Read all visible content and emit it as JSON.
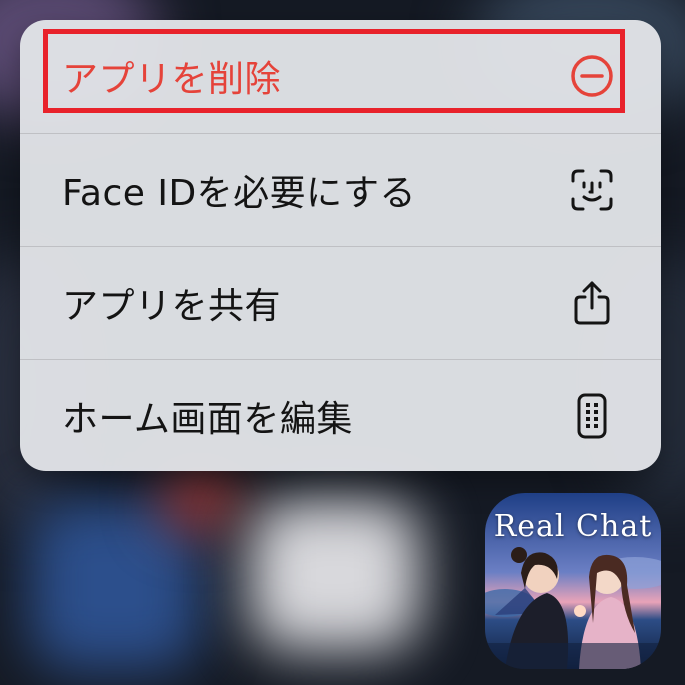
{
  "context_menu": {
    "items": [
      {
        "label": "アプリを削除",
        "icon": "minus-circle-icon",
        "destructive": true
      },
      {
        "label": "Face IDを必要にする",
        "icon": "face-id-icon",
        "destructive": false
      },
      {
        "label": "アプリを共有",
        "icon": "share-icon",
        "destructive": false
      },
      {
        "label": "ホーム画面を編集",
        "icon": "phone-grid-icon",
        "destructive": false
      }
    ]
  },
  "app_icon": {
    "title": "Real Chat"
  },
  "colors": {
    "destructive": "#e5433a",
    "highlight_border": "#e8222b",
    "menu_background": "#e2e4e8",
    "text": "#141414"
  }
}
